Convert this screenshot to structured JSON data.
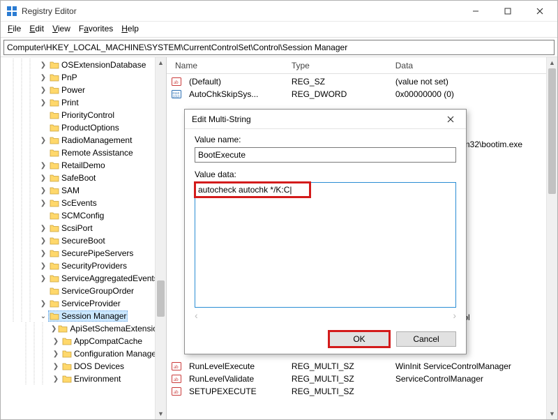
{
  "window": {
    "title": "Registry Editor",
    "address": "Computer\\HKEY_LOCAL_MACHINE\\SYSTEM\\CurrentControlSet\\Control\\Session Manager"
  },
  "menus": {
    "file": "File",
    "edit": "Edit",
    "view": "View",
    "favorites": "Favorites",
    "help": "Help"
  },
  "tree": {
    "items": [
      {
        "label": "OSExtensionDatabase",
        "exp": ">"
      },
      {
        "label": "PnP",
        "exp": ">"
      },
      {
        "label": "Power",
        "exp": ">"
      },
      {
        "label": "Print",
        "exp": ">"
      },
      {
        "label": "PriorityControl",
        "exp": ""
      },
      {
        "label": "ProductOptions",
        "exp": ""
      },
      {
        "label": "RadioManagement",
        "exp": ">"
      },
      {
        "label": "Remote Assistance",
        "exp": ""
      },
      {
        "label": "RetailDemo",
        "exp": ">"
      },
      {
        "label": "SafeBoot",
        "exp": ">"
      },
      {
        "label": "SAM",
        "exp": ">"
      },
      {
        "label": "ScEvents",
        "exp": ">"
      },
      {
        "label": "SCMConfig",
        "exp": ""
      },
      {
        "label": "ScsiPort",
        "exp": ">"
      },
      {
        "label": "SecureBoot",
        "exp": ">"
      },
      {
        "label": "SecurePipeServers",
        "exp": ">"
      },
      {
        "label": "SecurityProviders",
        "exp": ">"
      },
      {
        "label": "ServiceAggregatedEvents",
        "exp": ">"
      },
      {
        "label": "ServiceGroupOrder",
        "exp": ""
      },
      {
        "label": "ServiceProvider",
        "exp": ">"
      },
      {
        "label": "Session Manager",
        "exp": "v",
        "selected": true
      }
    ],
    "children": [
      "ApiSetSchemaExtensions",
      "AppCompatCache",
      "Configuration Manager",
      "DOS Devices",
      "Environment"
    ],
    "scroll_marker": "^"
  },
  "columns": {
    "name": "Name",
    "type": "Type",
    "data": "Data"
  },
  "col_widths": {
    "name": 168,
    "type": 150,
    "data": 240
  },
  "values_top": [
    {
      "icon": "sz",
      "name": "(Default)",
      "type": "REG_SZ",
      "data": "(value not set)"
    },
    {
      "icon": "bin",
      "name": "AutoChkSkipSys...",
      "type": "REG_DWORD",
      "data": "0x00000000 (0)"
    }
  ],
  "values_peek": [
    {
      "text": "em32\\bootim.exe"
    },
    {
      "text": ""
    },
    {
      "text": "trol"
    }
  ],
  "values_bottom": [
    {
      "icon": "sz",
      "name": "RunLevelExecute",
      "type": "REG_MULTI_SZ",
      "data": "WinInit ServiceControlManager"
    },
    {
      "icon": "sz",
      "name": "RunLevelValidate",
      "type": "REG_MULTI_SZ",
      "data": "ServiceControlManager"
    },
    {
      "icon": "sz",
      "name": "SETUPEXECUTE",
      "type": "REG_MULTI_SZ",
      "data": ""
    }
  ],
  "dialog": {
    "title": "Edit Multi-String",
    "labels": {
      "name": "Value name:",
      "data": "Value data:"
    },
    "value_name": "BootExecute",
    "value_data": "autocheck autochk */K:C|",
    "buttons": {
      "ok": "OK",
      "cancel": "Cancel"
    }
  }
}
